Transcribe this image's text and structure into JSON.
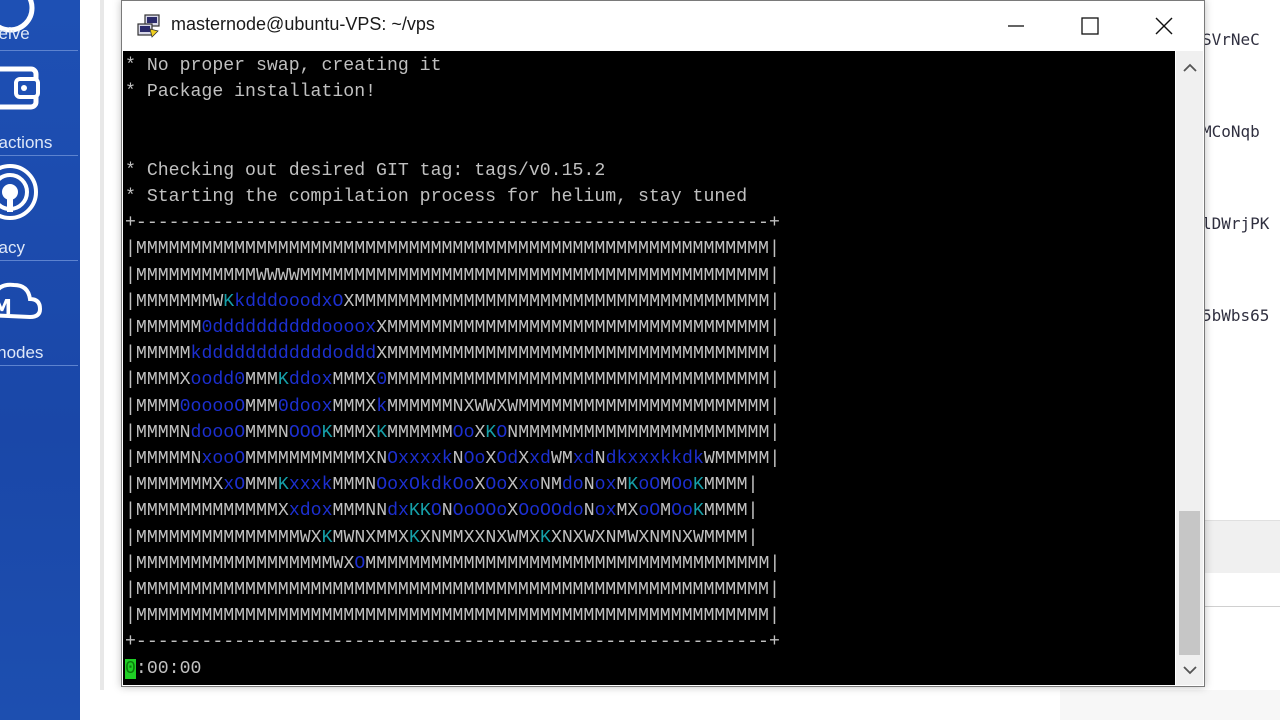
{
  "sidebar": {
    "items": [
      {
        "label": "ceive",
        "icon": "receive-icon"
      },
      {
        "label": "sactions",
        "icon": "transactions-icon"
      },
      {
        "label": "vacy",
        "icon": "privacy-icon"
      },
      {
        "label": "ernodes",
        "icon": "masternodes-icon"
      }
    ]
  },
  "background": {
    "addresses": [
      "SVrNeC",
      "MCoNqb",
      "lDWrjPK",
      "5bWbs65"
    ]
  },
  "window": {
    "title": "masternode@ubuntu-VPS: ~/vps",
    "minimize_icon": "minimize-icon",
    "maximize_icon": "maximize-icon",
    "close_icon": "close-icon"
  },
  "terminal": {
    "lines": [
      "* No proper swap, creating it",
      "* Package installation!",
      "",
      "",
      "* Checking out desired GIT tag: tags/v0.15.2",
      "* Starting the compilation process for helium, stay tuned",
      "+----------------------------------------------------------+",
      "|MMMMMMMMMMMMMMMMMMMMMMMMMMMMMMMMMMMMMMMMMMMMMMMMMMMMMMMMMM|",
      "|MMMMMMMMMMMWWWWMMMMMMMMMMMMMMMMMMMMMMMMMMMMMMMMMMMMMMMMMMM|",
      "|MMMMMMMWKkdddooodxOXMMMMMMMMMMMMMMMMMMMMMMMMMMMMMMMMMMMMMM|",
      "|MMMMMM0ddddddddddooooxXMMMMMMMMMMMMMMMMMMMMMMMMMMMMMMMMMMM|",
      "|MMMMMkddddddddddddodddXMMMMMMMMMMMMMMMMMMMMMMMMMMMMMMMMMMM|",
      "|MMMMXoodd0MMMKddoxMMMX0MMMMMMMMMMMMMMMMMMMMMMMMMMMMMMMMMMM|",
      "|MMMM0ooooOMMM0dooxMMMXkMMMMMMNXWWXWMMMMMMMMMMMMMMMMMMMMMMM|",
      "|MMMMNdoooOMMMNOOOKMMMXKMMMMMMOoXKONMMMMMMMMMMMMMMMMMMMMMMM|",
      "|MMMMMNxooOMMMMMMMMMMMXNOxxxxkNOoXOdXxdWMxdNdkxxxkkdkWMMMMM|",
      "|MMMMMMMXxOMMMKxxxkMMMNOoxOkdkOoXOoXxoNMdoNoxMKoOMOoKMMMM|",
      "|MMMMMMMMMMMMMXxdoxMMMNNdxKKONOoOOoXOoOOdoNoxMXoOMOoKMMMM|",
      "|MMMMMMMMMMMMMMMWXKMWNXMMXKXNMMXXNXWMXKXNXWXNMWXNMNXWMMMM|",
      "|MMMMMMMMMMMMMMMMMMWXOMMMMMMMMMMMMMMMMMMMMMMMMMMMMMMMMMMMMM|",
      "|MMMMMMMMMMMMMMMMMMMMMMMMMMMMMMMMMMMMMMMMMMMMMMMMMMMMMMMMMM|",
      "|MMMMMMMMMMMMMMMMMMMMMMMMMMMMMMMMMMMMMMMMMMMMMMMMMMMMMMMMMM|",
      "+----------------------------------------------------------+"
    ],
    "cursor_char": "0",
    "prompt_rest": ":00:00"
  },
  "colors": {
    "terminal_bg": "#000000",
    "terminal_fg": "#c0c0c0",
    "logo_blue": "#1c2fd0",
    "logo_cyan": "#159fa8",
    "cursor": "#1fcf25",
    "sidebar": "#1e50b4"
  }
}
